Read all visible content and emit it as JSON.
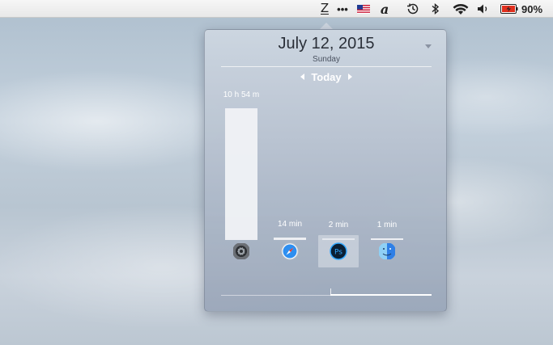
{
  "menubar": {
    "items": [
      {
        "name": "zen-app",
        "label": "Z"
      },
      {
        "name": "more",
        "label": "•••"
      },
      {
        "name": "input-source",
        "icon": "us-flag-icon"
      },
      {
        "name": "dictionary",
        "label": "a"
      },
      {
        "name": "time-machine",
        "icon": "time-machine-icon"
      },
      {
        "name": "bluetooth",
        "icon": "bluetooth-icon"
      },
      {
        "name": "wifi",
        "icon": "wifi-icon"
      },
      {
        "name": "volume",
        "icon": "speaker-icon"
      },
      {
        "name": "battery",
        "icon": "battery-charging-icon"
      }
    ],
    "battery_percent": "90%"
  },
  "popover": {
    "date": "July 12, 2015",
    "weekday": "Sunday",
    "nav_label": "Today",
    "slider_fraction": 0.52
  },
  "chart_data": {
    "type": "bar",
    "categories": [
      "System Preferences",
      "Safari",
      "Photoshop",
      "Finder"
    ],
    "values_minutes": [
      654,
      14,
      2,
      1
    ],
    "labels": [
      "10 h 54 m",
      "14 min",
      "2 min",
      "1 min"
    ],
    "selected_index": 2,
    "icons": [
      "system-preferences-icon",
      "safari-icon",
      "photoshop-icon",
      "finder-icon"
    ],
    "colors": {
      "bar": "#f0f2f6",
      "selected_slot": "#dce2ea"
    }
  }
}
